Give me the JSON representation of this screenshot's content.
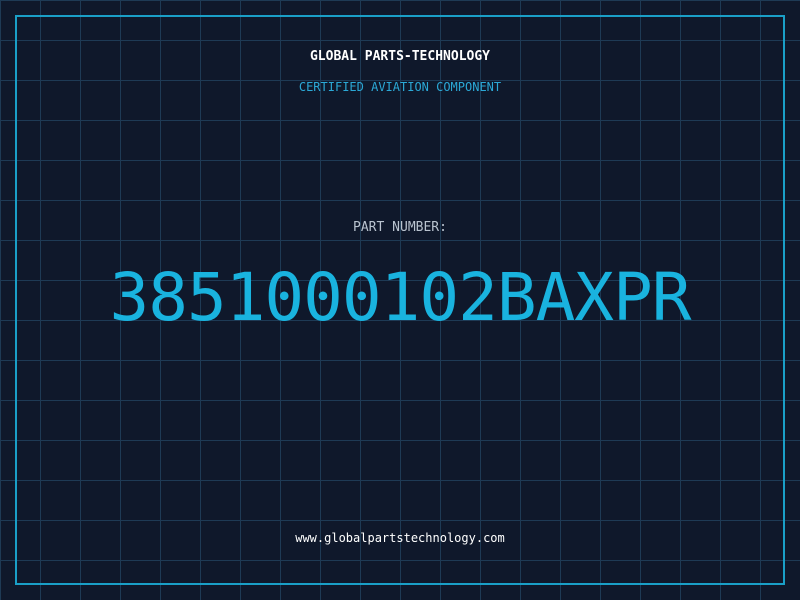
{
  "header": {
    "company_name": "GLOBAL PARTS-TECHNOLOGY",
    "tagline": "CERTIFIED AVIATION COMPONENT"
  },
  "part": {
    "label": "PART NUMBER:",
    "number": "3851000102BAXPR"
  },
  "footer": {
    "website": "www.globalpartstechnology.com"
  },
  "colors": {
    "background": "#0f182b",
    "grid": "#1e3a55",
    "accent": "#19b3df",
    "frame": "#1a9fc7"
  }
}
